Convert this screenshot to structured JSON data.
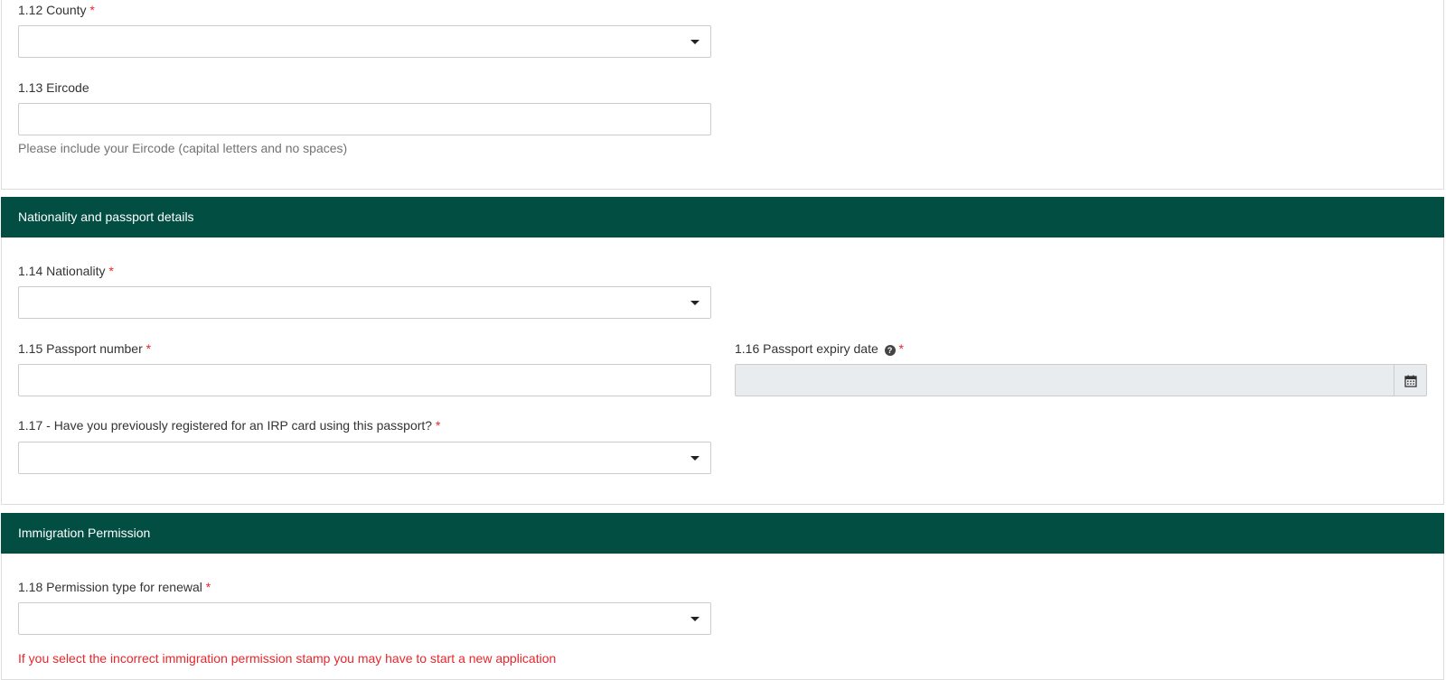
{
  "address": {
    "county": {
      "label": "1.12 County",
      "required_mark": "*",
      "value": ""
    },
    "eircode": {
      "label": "1.13 Eircode",
      "value": "",
      "help": "Please include your Eircode (capital letters and no spaces)"
    }
  },
  "nationality_section": {
    "heading": "Nationality and passport details",
    "nationality": {
      "label": "1.14 Nationality",
      "required_mark": "*",
      "value": ""
    },
    "passport_number": {
      "label": "1.15 Passport number",
      "required_mark": "*",
      "value": ""
    },
    "passport_expiry": {
      "label": "1.16 Passport expiry date",
      "required_mark": "*",
      "help_icon": "question-circle-icon",
      "calendar_icon": "calendar-icon",
      "value": ""
    },
    "previous_irp": {
      "label": "1.17 - Have you previously registered for an IRP card using this passport?",
      "required_mark": "*",
      "value": ""
    }
  },
  "immigration_section": {
    "heading": "Immigration Permission",
    "permission_type": {
      "label": "1.18 Permission type for renewal",
      "required_mark": "*",
      "value": ""
    },
    "warning": "If you select the incorrect immigration permission stamp you may have to start a new application"
  },
  "colors": {
    "header_bg": "#034e43",
    "required": "#e8262c",
    "help_text": "#737373"
  }
}
